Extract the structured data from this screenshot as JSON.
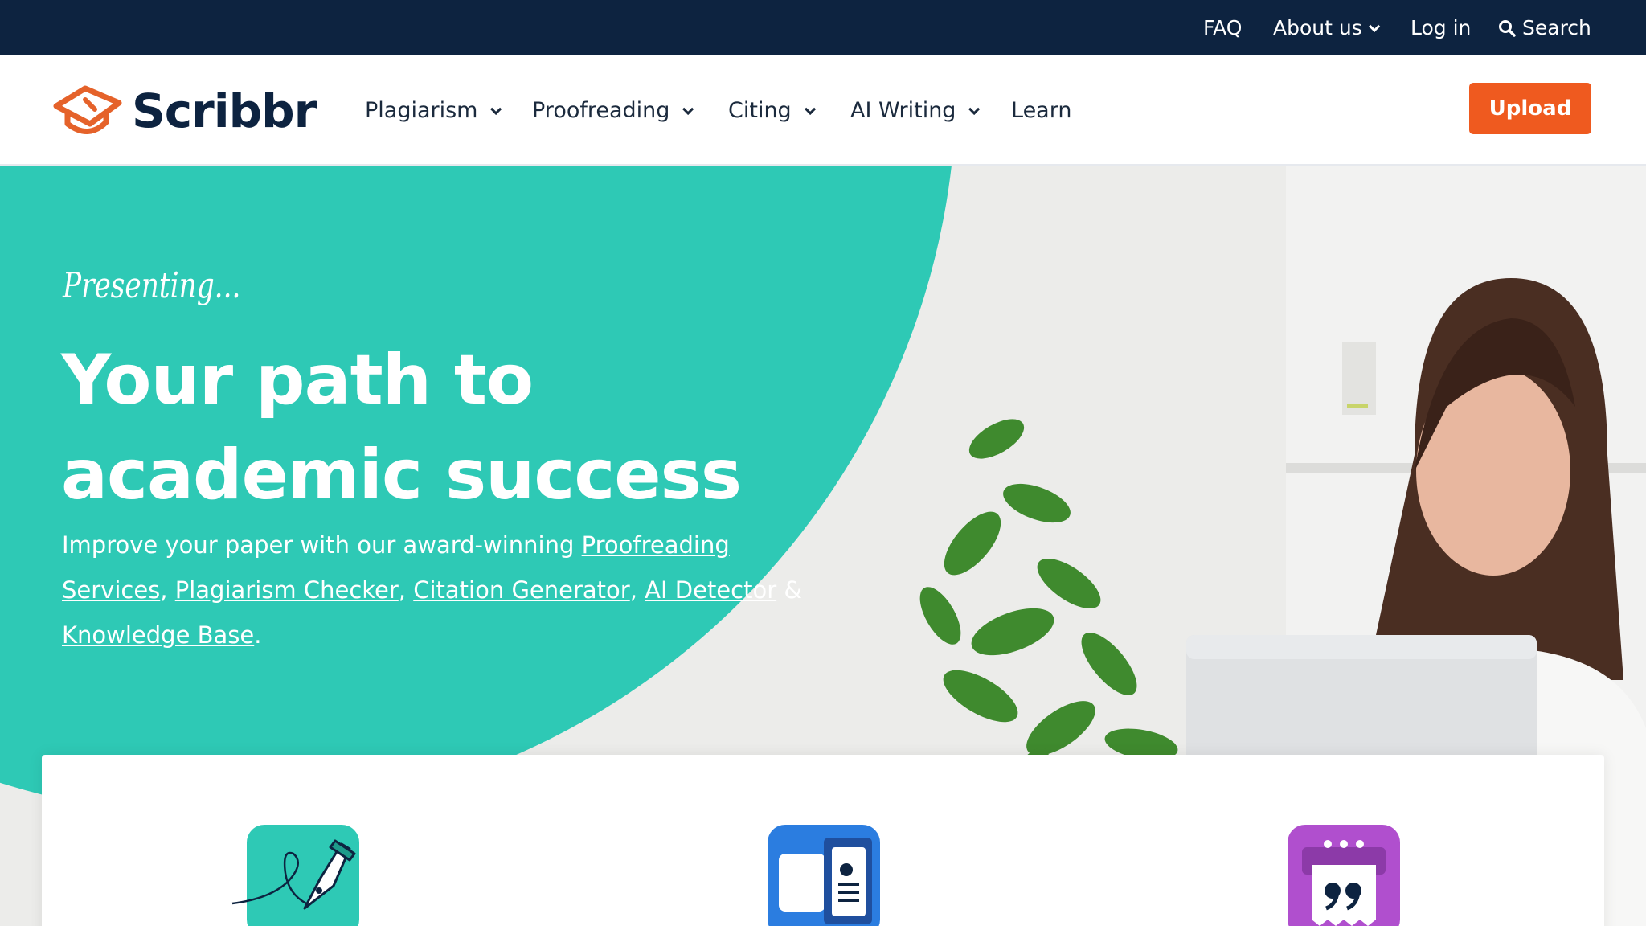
{
  "topbar": {
    "faq": "FAQ",
    "about": "About us",
    "login": "Log in",
    "search": "Search"
  },
  "header": {
    "logo_text": "Scribbr",
    "nav": {
      "plagiarism": "Plagiarism",
      "proofreading": "Proofreading",
      "citing": "Citing",
      "ai_writing": "AI Writing",
      "learn": "Learn"
    },
    "upload": "Upload"
  },
  "hero": {
    "tagline": "Presenting...",
    "headline_line1": "Your path to",
    "headline_line2": "academic success",
    "sub_prefix": "Improve your paper with our award-winning",
    "links": {
      "proofreading": "Proofreading Services",
      "plagiarism": "Plagiarism Checker",
      "citation": "Citation Generator",
      "ai_detector": "AI Detector",
      "knowledge": "Knowledge Base"
    },
    "comma": ",",
    "amp": "&",
    "period": "."
  },
  "products": {
    "icons": [
      "pen-signature-icon",
      "document-compare-icon",
      "quote-generator-icon"
    ]
  },
  "colors": {
    "navy": "#0d2340",
    "teal": "#2ec9b5",
    "orange": "#ef5a1f",
    "blue": "#2b7de0",
    "purple": "#b04fce"
  }
}
